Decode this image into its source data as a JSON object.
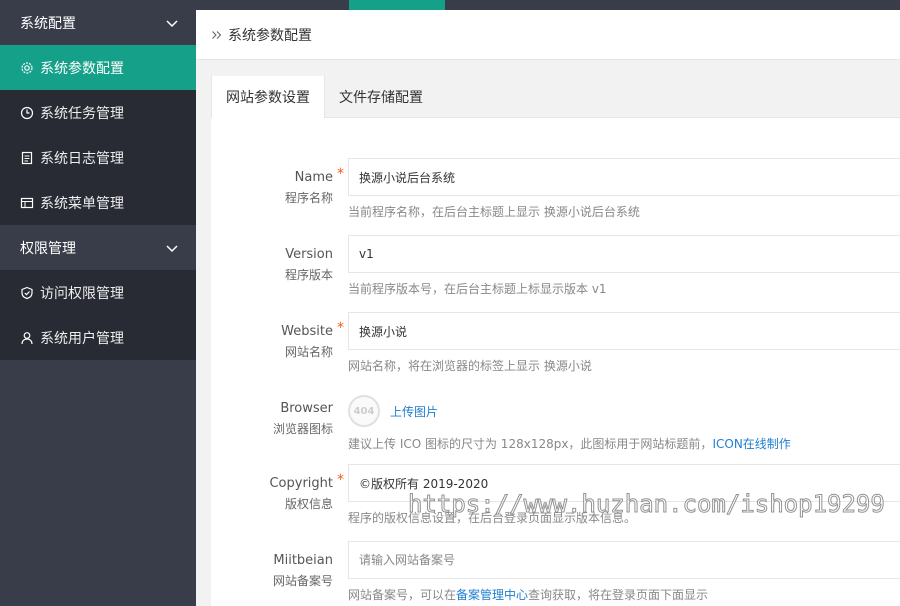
{
  "sidebar": {
    "groups": [
      {
        "label": "系统配置",
        "items": [
          {
            "label": "系统参数配置",
            "icon": "gear-icon",
            "active": true
          },
          {
            "label": "系统任务管理",
            "icon": "clock-icon"
          },
          {
            "label": "系统日志管理",
            "icon": "log-icon"
          },
          {
            "label": "系统菜单管理",
            "icon": "menu-icon"
          }
        ]
      },
      {
        "label": "权限管理",
        "items": [
          {
            "label": "访问权限管理",
            "icon": "shield-icon"
          },
          {
            "label": "系统用户管理",
            "icon": "user-icon"
          }
        ]
      }
    ]
  },
  "breadcrumb": {
    "title": "系统参数配置"
  },
  "tabs": [
    {
      "label": "网站参数设置",
      "active": true
    },
    {
      "label": "文件存储配置"
    }
  ],
  "form": {
    "name": {
      "label_en": "Name",
      "label_zh": "程序名称",
      "value": "换源小说后台系统",
      "help": "当前程序名称，在后台主标题上显示 换源小说后台系统"
    },
    "version": {
      "label_en": "Version",
      "label_zh": "程序版本",
      "value": "v1",
      "help": "当前程序版本号，在后台主标题上标显示版本 v1"
    },
    "website": {
      "label_en": "Website",
      "label_zh": "网站名称",
      "value": "换源小说",
      "help": "网站名称，将在浏览器的标签上显示 换源小说"
    },
    "browser": {
      "label_en": "Browser",
      "label_zh": "浏览器图标",
      "placeholder_text": "404",
      "upload_label": "上传图片",
      "help_prefix": "建议上传 ICO 图标的尺寸为 128x128px，此图标用于网站标题前，",
      "help_link": "ICON在线制作"
    },
    "copyright": {
      "label_en": "Copyright",
      "label_zh": "版权信息",
      "value": "©版权所有 2019-2020",
      "help": "程序的版权信息设置，在后台登录页面显示版本信息。"
    },
    "miitbeian": {
      "label_en": "Miitbeian",
      "label_zh": "网站备案号",
      "placeholder": "请输入网站备案号",
      "help_prefix": "网站备案号，可以在",
      "help_link": "备案管理中心",
      "help_suffix": "查询获取，将在登录页面下面显示"
    }
  },
  "watermark": "https://www.huzhan.com/ishop19299",
  "colors": {
    "accent": "#15a08a",
    "sidebar": "#393d49",
    "sidebar_item": "#282b33",
    "required": "#ff5722",
    "link": "#1e7fd1"
  }
}
